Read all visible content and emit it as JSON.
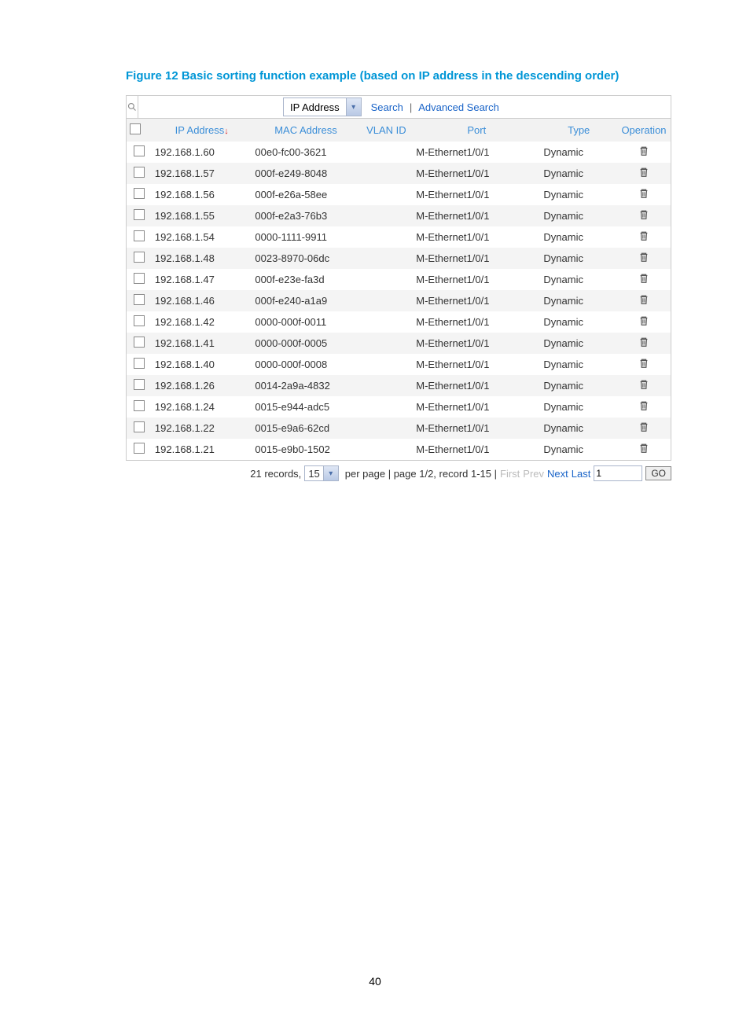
{
  "caption": "Figure 12 Basic sorting function example (based on IP address in the descending order)",
  "search": {
    "field_option": "IP Address",
    "search_label": "Search",
    "advanced_label": "Advanced Search"
  },
  "headers": {
    "ip": "IP Address",
    "mac": "MAC Address",
    "vlan": "VLAN ID",
    "port": "Port",
    "type": "Type",
    "operation": "Operation"
  },
  "rows": [
    {
      "ip": "192.168.1.60",
      "mac": "00e0-fc00-3621",
      "vlan": "",
      "port": "M-Ethernet1/0/1",
      "type": "Dynamic"
    },
    {
      "ip": "192.168.1.57",
      "mac": "000f-e249-8048",
      "vlan": "",
      "port": "M-Ethernet1/0/1",
      "type": "Dynamic"
    },
    {
      "ip": "192.168.1.56",
      "mac": "000f-e26a-58ee",
      "vlan": "",
      "port": "M-Ethernet1/0/1",
      "type": "Dynamic"
    },
    {
      "ip": "192.168.1.55",
      "mac": "000f-e2a3-76b3",
      "vlan": "",
      "port": "M-Ethernet1/0/1",
      "type": "Dynamic"
    },
    {
      "ip": "192.168.1.54",
      "mac": "0000-1111-9911",
      "vlan": "",
      "port": "M-Ethernet1/0/1",
      "type": "Dynamic"
    },
    {
      "ip": "192.168.1.48",
      "mac": "0023-8970-06dc",
      "vlan": "",
      "port": "M-Ethernet1/0/1",
      "type": "Dynamic"
    },
    {
      "ip": "192.168.1.47",
      "mac": "000f-e23e-fa3d",
      "vlan": "",
      "port": "M-Ethernet1/0/1",
      "type": "Dynamic"
    },
    {
      "ip": "192.168.1.46",
      "mac": "000f-e240-a1a9",
      "vlan": "",
      "port": "M-Ethernet1/0/1",
      "type": "Dynamic"
    },
    {
      "ip": "192.168.1.42",
      "mac": "0000-000f-0011",
      "vlan": "",
      "port": "M-Ethernet1/0/1",
      "type": "Dynamic"
    },
    {
      "ip": "192.168.1.41",
      "mac": "0000-000f-0005",
      "vlan": "",
      "port": "M-Ethernet1/0/1",
      "type": "Dynamic"
    },
    {
      "ip": "192.168.1.40",
      "mac": "0000-000f-0008",
      "vlan": "",
      "port": "M-Ethernet1/0/1",
      "type": "Dynamic"
    },
    {
      "ip": "192.168.1.26",
      "mac": "0014-2a9a-4832",
      "vlan": "",
      "port": "M-Ethernet1/0/1",
      "type": "Dynamic"
    },
    {
      "ip": "192.168.1.24",
      "mac": "0015-e944-adc5",
      "vlan": "",
      "port": "M-Ethernet1/0/1",
      "type": "Dynamic"
    },
    {
      "ip": "192.168.1.22",
      "mac": "0015-e9a6-62cd",
      "vlan": "",
      "port": "M-Ethernet1/0/1",
      "type": "Dynamic"
    },
    {
      "ip": "192.168.1.21",
      "mac": "0015-e9b0-1502",
      "vlan": "",
      "port": "M-Ethernet1/0/1",
      "type": "Dynamic"
    }
  ],
  "pager": {
    "records_prefix": "21 records,",
    "per_page": "15",
    "middle": "per page | page 1/2, record 1-15 |",
    "first": "First",
    "prev": "Prev",
    "next": "Next",
    "last": "Last",
    "page_input": "1",
    "go": "GO"
  },
  "page_number": "40"
}
